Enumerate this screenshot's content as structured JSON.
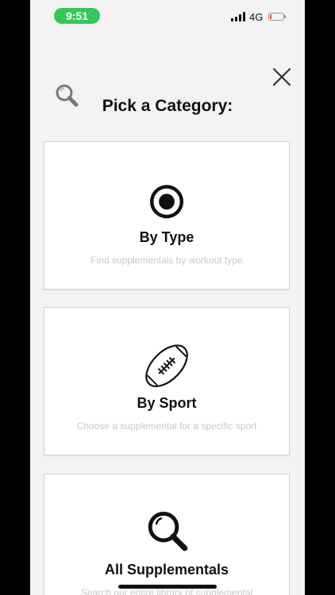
{
  "status_bar": {
    "time": "9:51",
    "network": "4G",
    "signal_bars": 4,
    "battery_level": 0.15,
    "colors": {
      "time_pill": "#35c759",
      "battery_low": "#ff3b30"
    }
  },
  "header": {
    "title": "Pick a Category:",
    "search_icon": "search-icon",
    "close_icon": "close-icon"
  },
  "categories": [
    {
      "icon": "target-icon",
      "title": "By Type",
      "description": "Find supplementals by workout type"
    },
    {
      "icon": "football-icon",
      "title": "By Sport",
      "description": "Choose a supplemental for a specific sport"
    },
    {
      "icon": "search-icon",
      "title": "All Supplementals",
      "description": "Search our entire library of supplemental"
    }
  ]
}
